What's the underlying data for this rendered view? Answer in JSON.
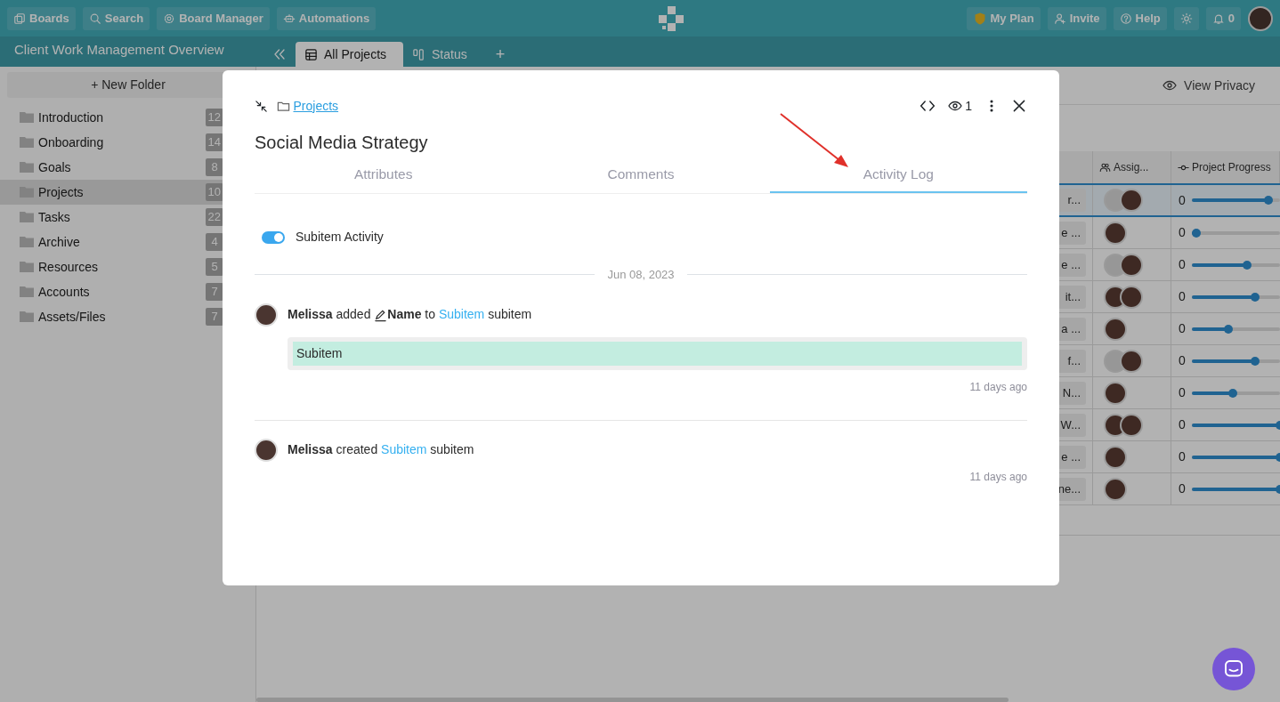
{
  "topbar": {
    "left_buttons": [
      {
        "kind": "boards",
        "label": "Boards"
      },
      {
        "kind": "search",
        "label": "Search"
      },
      {
        "kind": "gear",
        "label": "Board Manager"
      },
      {
        "kind": "robot",
        "label": "Automations"
      }
    ],
    "right_buttons": [
      {
        "kind": "shield",
        "label": "My Plan"
      },
      {
        "kind": "user-plus",
        "label": "Invite"
      },
      {
        "kind": "help",
        "label": "Help"
      },
      {
        "kind": "sun"
      },
      {
        "kind": "bell",
        "label": "0"
      }
    ]
  },
  "subbar": {
    "title": "Client Work Management Overview",
    "views": [
      {
        "kind": "table",
        "label": "All Projects",
        "selected": true
      },
      {
        "kind": "board",
        "label": "Status",
        "selected": false
      }
    ],
    "add": "+"
  },
  "sidebar": {
    "new_folder": {
      "icon": "+",
      "label": "New Folder"
    },
    "folders": [
      {
        "label": "Introduction",
        "count": "12",
        "selected": false
      },
      {
        "label": "Onboarding",
        "count": "14",
        "selected": false
      },
      {
        "label": "Goals",
        "count": "8",
        "selected": false
      },
      {
        "label": "Projects",
        "count": "10",
        "selected": true
      },
      {
        "label": "Tasks",
        "count": "22",
        "selected": false
      },
      {
        "label": "Archive",
        "count": "4",
        "selected": false
      },
      {
        "label": "Resources",
        "count": "5",
        "selected": false
      },
      {
        "label": "Accounts",
        "count": "7",
        "selected": false
      },
      {
        "label": "Assets/Files",
        "count": "7",
        "selected": false
      }
    ]
  },
  "content": {
    "view_privacy": "View Privacy",
    "columns": [
      {
        "kind": "people",
        "label": "Assig..."
      },
      {
        "kind": "progress",
        "label": "Project Progress"
      }
    ],
    "rows": [
      {
        "name": "r...",
        "selected": true,
        "assignees": [
          {
            "kind": "silhouette"
          },
          {
            "kind": "photo"
          }
        ],
        "progress": "0",
        "level": 0.87
      },
      {
        "name": "e ...",
        "selected": false,
        "assignees": [
          {
            "kind": "photo"
          }
        ],
        "progress": "0",
        "level": 0.05
      },
      {
        "name": "e ...",
        "selected": false,
        "assignees": [
          {
            "kind": "silhouette"
          },
          {
            "kind": "photo"
          }
        ],
        "progress": "0",
        "level": 0.63
      },
      {
        "name": "it...",
        "selected": false,
        "assignees": [
          {
            "kind": "photo"
          },
          {
            "kind": "photo"
          }
        ],
        "progress": "0",
        "level": 0.72
      },
      {
        "name": "a ...",
        "selected": false,
        "assignees": [
          {
            "kind": "photo"
          }
        ],
        "progress": "0",
        "level": 0.42
      },
      {
        "name": "f...",
        "selected": false,
        "assignees": [
          {
            "kind": "silhouette"
          },
          {
            "kind": "photo"
          }
        ],
        "progress": "0",
        "level": 0.72
      },
      {
        "name": "N...",
        "selected": false,
        "assignees": [
          {
            "kind": "photo"
          }
        ],
        "progress": "0",
        "level": 0.47
      },
      {
        "name": "W...",
        "selected": false,
        "assignees": [
          {
            "kind": "photo"
          },
          {
            "kind": "photo"
          }
        ],
        "progress": "0",
        "level": 1
      },
      {
        "name": "e ...",
        "selected": false,
        "assignees": [
          {
            "kind": "photo"
          }
        ],
        "progress": "0",
        "level": 1
      },
      {
        "name": "ne...",
        "selected": false,
        "assignees": [
          {
            "kind": "photo"
          }
        ],
        "progress": "0",
        "level": 1
      }
    ]
  },
  "modal": {
    "breadcrumb": "Projects",
    "viewers": "1",
    "title": "Social Media Strategy",
    "tabs": [
      {
        "label": "Attributes",
        "selected": false
      },
      {
        "label": "Comments",
        "selected": false
      },
      {
        "label": "Activity Log",
        "selected": true
      }
    ],
    "subitem_toggle": {
      "label": "Subitem Activity",
      "on": true
    },
    "date": "Jun 08, 2023",
    "activity": [
      {
        "kind": "added",
        "user": "Melissa",
        "verb": "added",
        "field": "Name",
        "preposition": "to",
        "link": "Subitem",
        "suffix": "subitem",
        "value": "Subitem",
        "time": "11 days ago"
      },
      {
        "kind": "created",
        "user": "Melissa",
        "verb": "created",
        "link": "Subitem",
        "suffix": "subitem",
        "time": "11 days ago"
      }
    ]
  }
}
